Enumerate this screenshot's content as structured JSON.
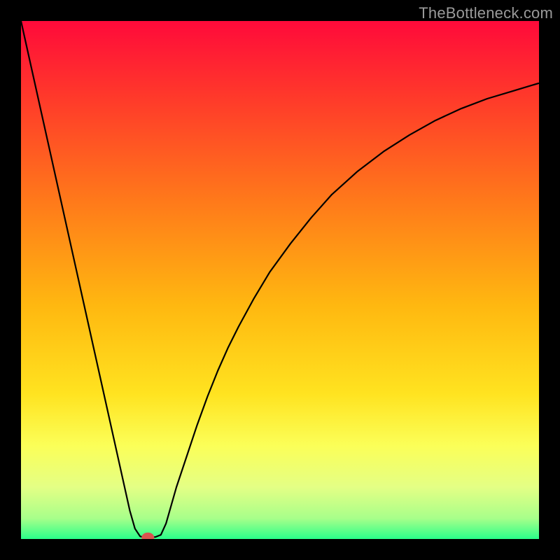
{
  "watermark": "TheBottleneck.com",
  "chart_data": {
    "type": "line",
    "title": "",
    "xlabel": "",
    "ylabel": "",
    "xlim": [
      0,
      100
    ],
    "ylim": [
      0,
      100
    ],
    "grid": false,
    "series": [
      {
        "name": "bottleneck-curve",
        "x": [
          0,
          2,
          4,
          6,
          8,
          10,
          12,
          14,
          16,
          18,
          20,
          21,
          22,
          23,
          24,
          25,
          26,
          27,
          28,
          30,
          32,
          34,
          36,
          38,
          40,
          42,
          45,
          48,
          52,
          56,
          60,
          65,
          70,
          75,
          80,
          85,
          90,
          95,
          100
        ],
        "y": [
          100,
          91,
          82,
          73,
          64,
          55,
          46,
          37,
          28,
          19,
          10,
          5.5,
          2.0,
          0.5,
          0.3,
          0.3,
          0.4,
          0.8,
          3.0,
          10,
          16,
          22,
          27.5,
          32.5,
          37,
          41,
          46.5,
          51.5,
          57,
          62,
          66.5,
          71,
          74.8,
          78,
          80.8,
          83.1,
          85,
          86.5,
          88
        ]
      }
    ],
    "marker": {
      "name": "optimum-point",
      "x": 24.5,
      "y": 0.3,
      "color": "#d9534f"
    },
    "background_gradient": {
      "stops": [
        {
          "offset": 0.0,
          "color": "#ff0a3a"
        },
        {
          "offset": 0.15,
          "color": "#ff3a2a"
        },
        {
          "offset": 0.35,
          "color": "#ff7a1a"
        },
        {
          "offset": 0.55,
          "color": "#ffb810"
        },
        {
          "offset": 0.72,
          "color": "#ffe320"
        },
        {
          "offset": 0.82,
          "color": "#fbff58"
        },
        {
          "offset": 0.9,
          "color": "#e4ff85"
        },
        {
          "offset": 0.96,
          "color": "#a8ff8a"
        },
        {
          "offset": 1.0,
          "color": "#2aff8a"
        }
      ]
    }
  }
}
